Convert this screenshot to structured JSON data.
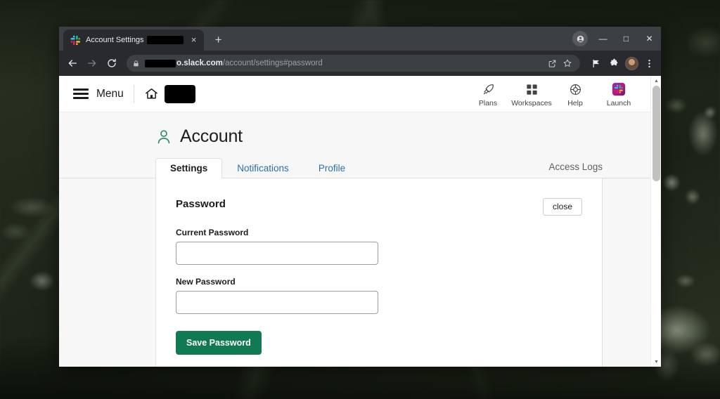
{
  "browser": {
    "tab": {
      "favicon": "slack-logo-icon",
      "title": "Account Settings",
      "title_redacted": true,
      "close_label": "×"
    },
    "new_tab_label": "+",
    "window_controls": {
      "minimize": "—",
      "maximize": "□",
      "close": "✕"
    },
    "profile_badge": "profile-avatar-icon",
    "nav": {
      "back": "←",
      "forward": "→",
      "reload": "⟳"
    },
    "omnibox": {
      "lock_icon": "lock-icon",
      "url_redacted_prefix": true,
      "url_host": "o.slack.com",
      "url_path": "/account/settings#password",
      "share_icon": "share-icon",
      "bookmark_icon": "star-icon"
    },
    "extensions": [
      {
        "name": "flag-extension-icon",
        "glyph": "⚑"
      },
      {
        "name": "puzzle-extensions-icon",
        "glyph": "❖"
      },
      {
        "name": "profile-avatar-icon",
        "glyph": ""
      },
      {
        "name": "chrome-menu-icon",
        "glyph": "⋮"
      }
    ]
  },
  "app_header": {
    "menu_label": "Menu",
    "home_icon": "home-icon",
    "workspace_name_redacted": true,
    "nav_items": [
      {
        "label": "Plans",
        "icon": "rocket-icon"
      },
      {
        "label": "Workspaces",
        "icon": "grid-icon"
      },
      {
        "label": "Help",
        "icon": "lifebuoy-icon"
      },
      {
        "label": "Launch",
        "icon": "slack-launch-icon"
      }
    ]
  },
  "page": {
    "title": "Account",
    "title_icon": "person-icon",
    "tabs": [
      {
        "label": "Settings",
        "active": true
      },
      {
        "label": "Notifications",
        "active": false
      },
      {
        "label": "Profile",
        "active": false
      }
    ],
    "access_logs_label": "Access Logs",
    "card": {
      "title": "Password",
      "close_label": "close",
      "fields": [
        {
          "label": "Current Password",
          "value": "",
          "placeholder": ""
        },
        {
          "label": "New Password",
          "value": "",
          "placeholder": ""
        }
      ],
      "submit_label": "Save Password"
    },
    "scrollbar": {
      "up_arrow": "▲",
      "down_arrow": "▼",
      "thumb_position_pct": 0
    }
  },
  "colors": {
    "slack_green": "#117a52",
    "link_blue": "#2a71a5",
    "account_icon_green": "#2e8b6e",
    "browser_chrome": "#3c4043",
    "browser_toolbar": "#282a2d"
  }
}
